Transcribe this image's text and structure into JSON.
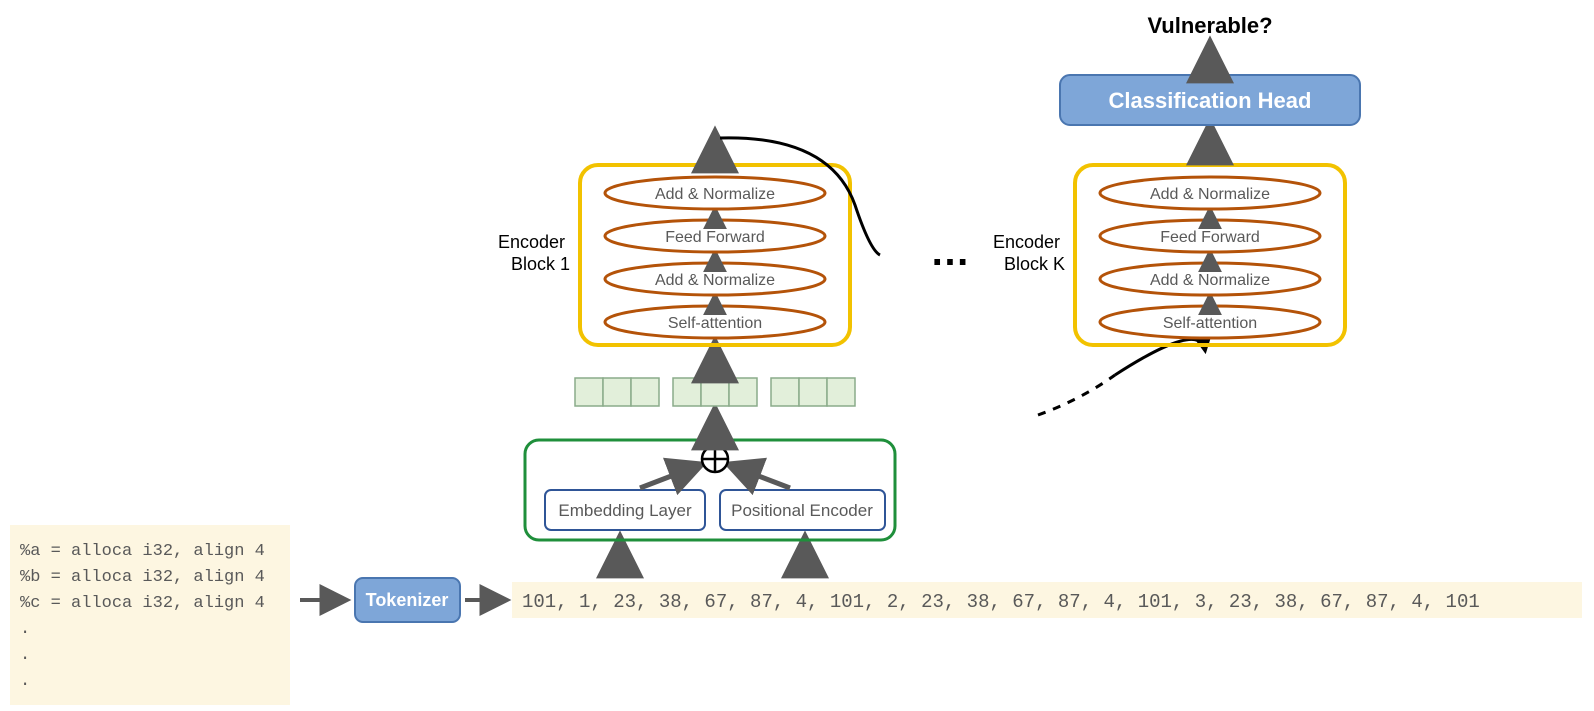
{
  "input_code": {
    "lines": [
      "%a = alloca i32, align 4",
      "%b = alloca i32, align 4",
      "%c = alloca i32, align 4",
      ".",
      ".",
      "."
    ]
  },
  "tokenizer": {
    "label": "Tokenizer"
  },
  "token_ids": "101, 1, 23, 38, 67, 87, 4, 101, 2, 23, 38, 67, 87, 4, 101, 3, 23, 38, 67, 87, 4, 101",
  "embed_block": {
    "embedding_label": "Embedding Layer",
    "positional_label": "Positional Encoder"
  },
  "encoder_block1": {
    "label_line1": "Encoder",
    "label_line2": "Block 1",
    "layers": [
      "Self-attention",
      "Add & Normalize",
      "Feed Forward",
      "Add & Normalize"
    ]
  },
  "encoder_blockK": {
    "label_line1": "Encoder",
    "label_line2": "Block K",
    "layers": [
      "Self-attention",
      "Add & Normalize",
      "Feed Forward",
      "Add & Normalize"
    ]
  },
  "ellipsis": "…",
  "classification_head": {
    "label": "Classification Head"
  },
  "output_label": "Vulnerable?",
  "colors": {
    "code_bg": "#fdf6e1",
    "token_bg": "#fdf6e1",
    "tokenizer_fill": "#7ea6d8",
    "tokenizer_stroke": "#4a76b0",
    "class_head_fill": "#7ea6d8",
    "class_head_stroke": "#4a76b0",
    "encoder_outline": "#f2c200",
    "pill_stroke": "#b45309",
    "embed_box_stroke": "#1f8f3b",
    "embed_inner_stroke": "#2f5597",
    "cell_fill": "#e2efda",
    "cell_stroke": "#8aab8a",
    "arrow": "#595959",
    "text_gray": "#595959",
    "text_black": "#000000"
  }
}
